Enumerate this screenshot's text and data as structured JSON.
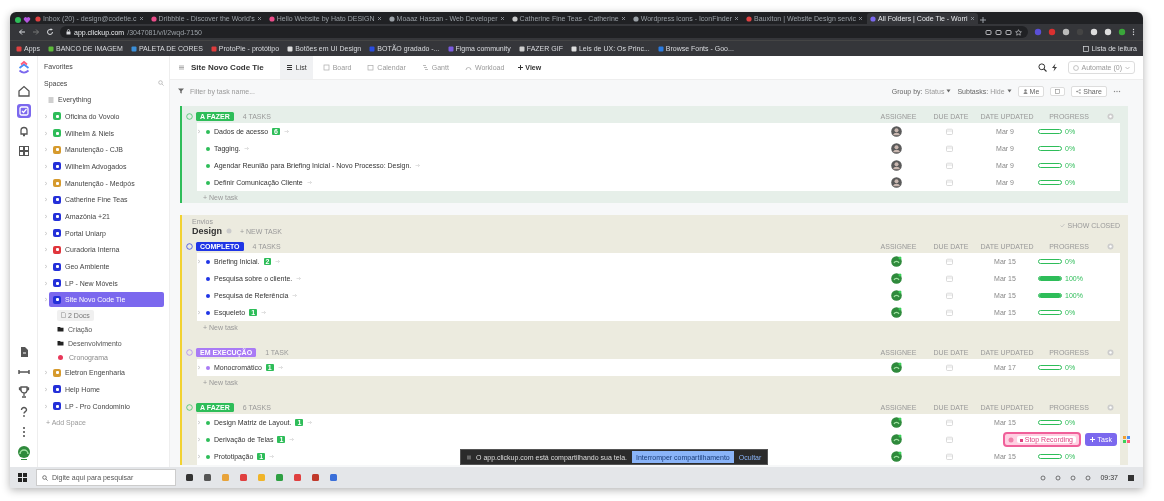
{
  "browser": {
    "tabs": [
      {
        "title": "Inbox (20) - design@codetie.c",
        "selected": false
      },
      {
        "title": "Dribbble - Discover the World's",
        "selected": false
      },
      {
        "title": "Hello Website by Hato DESIGN",
        "selected": false
      },
      {
        "title": "Moaaz Hassan - Web Developer",
        "selected": false
      },
      {
        "title": "Catherine Fine Teas - Catherine",
        "selected": false
      },
      {
        "title": "Wordpress icons - IconFinder",
        "selected": false
      },
      {
        "title": "Bauxiton | Website Design servic",
        "selected": false
      },
      {
        "title": "All Folders | Code Tie - Worri",
        "selected": true
      }
    ],
    "url_host": "app.clickup.com",
    "url_path": "/3047081/v/l/2wqd-7150",
    "bookmarks": [
      "Apps",
      "BANCO DE IMAGEM",
      "PALETA DE CORES",
      "ProtoPie - protótipo",
      "Botões em UI Design",
      "BOTÃO gradado -...",
      "Figma community",
      "FAZER GIF",
      "Leis de UX: Os Princ...",
      "Browse Fonts - Goo..."
    ],
    "reading_list": "Lista de leitura"
  },
  "rail": {
    "items": [
      {
        "kind": "home",
        "selected": false
      },
      {
        "kind": "tasks",
        "selected": true
      },
      {
        "kind": "notifications",
        "selected": false
      },
      {
        "kind": "apps",
        "selected": false
      }
    ],
    "bottom": [
      {
        "kind": "docs"
      },
      {
        "kind": "pulse"
      },
      {
        "kind": "goals"
      },
      {
        "kind": "help"
      },
      {
        "kind": "more"
      }
    ]
  },
  "sidebar": {
    "favorites": "Favorites",
    "spaces_label": "Spaces",
    "everything": "Everything",
    "spaces": [
      {
        "name": "Oficina do Vovoio",
        "color": "#2ebd59",
        "selected": false
      },
      {
        "name": "Wilhelm & Niels",
        "color": "#2ebd59",
        "selected": false
      },
      {
        "name": "Manutenção - CJB",
        "color": "#d69a2d",
        "selected": false
      },
      {
        "name": "Wilhelm Advogados",
        "color": "#2430d9",
        "selected": false
      },
      {
        "name": "Manutenção - Medpós",
        "color": "#d69a2d",
        "selected": false
      },
      {
        "name": "Catherine Fine Teas",
        "color": "#2430d9",
        "selected": false
      },
      {
        "name": "Amazônia +21",
        "color": "#2430d9",
        "selected": false
      },
      {
        "name": "Portal Uniarp",
        "color": "#2430d9",
        "selected": false
      },
      {
        "name": "Curadoria Interna",
        "color": "#e0353c",
        "selected": false
      },
      {
        "name": "Geo Ambiente",
        "color": "#2430d9",
        "selected": false
      },
      {
        "name": "LP - New Móveis",
        "color": "#2430d9",
        "selected": false
      },
      {
        "name": "Site Novo Code Tie",
        "color": "#2430d9",
        "selected": true,
        "children": [
          {
            "kind": "docs",
            "name": "2 Docs"
          },
          {
            "kind": "folder",
            "name": "Criação"
          },
          {
            "kind": "folder",
            "name": "Desenvolvimento"
          },
          {
            "kind": "list",
            "name": "Cronograma",
            "color": "#e8385a"
          }
        ]
      },
      {
        "name": "Eletron Engenharia",
        "color": "#d69a2d",
        "selected": false
      },
      {
        "name": "Help Home",
        "color": "#2430d9",
        "selected": false
      },
      {
        "name": "LP - Pro Condominio",
        "color": "#2430d9",
        "selected": false
      }
    ],
    "add_space": "+ Add Space"
  },
  "header": {
    "title": "Site Novo Code Tie",
    "views": [
      {
        "label": "List",
        "kind": "list",
        "selected": true
      },
      {
        "label": "Board",
        "kind": "board",
        "selected": false
      },
      {
        "label": "Calendar",
        "kind": "calendar",
        "selected": false
      },
      {
        "label": "Gantt",
        "kind": "gantt",
        "selected": false
      },
      {
        "label": "Workload",
        "kind": "workload",
        "selected": false
      }
    ],
    "add_view": "View",
    "automate": "Automate (0)"
  },
  "toolbar": {
    "filter_placeholder": "Filter by task name...",
    "group_by_label": "Group by:",
    "group_by": "Status",
    "subtasks_label": "Subtasks:",
    "subtasks": "Hide",
    "me": "Me",
    "share": "Share"
  },
  "lists": [
    {
      "color": "#2ebd59",
      "groups": [
        {
          "status": "A FAZER",
          "color": "#2ebd59",
          "count": "4 TASKS",
          "columns": [
            "ASSIGNEE",
            "DUE DATE",
            "DATE UPDATED",
            "PROGRESS"
          ],
          "new_task": "+ New task",
          "tasks": [
            {
              "name": "Dados de acesso",
              "subtasks": "6",
              "assignee": {
                "kind": "photo"
              },
              "date_updated": "Mar 9",
              "level": 0,
              "progress": "0%"
            },
            {
              "name": "Tagging.",
              "assignee": {
                "kind": "photo"
              },
              "date_updated": "Mar 9",
              "level": 0,
              "progress": "0%"
            },
            {
              "name": "Agendar Reunião para Briefing Inicial - Novo Processo: Design.",
              "assignee": {
                "kind": "photo"
              },
              "date_updated": "Mar 9",
              "level": 0,
              "progress": "0%"
            },
            {
              "name": "Definir Comunicação Cliente",
              "assignee": {
                "kind": "photo"
              },
              "date_updated": "Mar 9",
              "level": 0,
              "progress": "0%"
            }
          ]
        }
      ]
    },
    {
      "color": "#f2d230",
      "label": "Envios",
      "name": "Design",
      "new_task": "+ NEW TASK",
      "show_closed": "SHOW CLOSED",
      "groups": [
        {
          "status": "COMPLETO",
          "color": "#1f35e6",
          "count": "4 TASKS",
          "columns": [
            "ASSIGNEE",
            "DUE DATE",
            "DATE UPDATED",
            "PROGRESS"
          ],
          "new_task": "+ New task",
          "tasks": [
            {
              "name": "Briefing Inicial.",
              "subtasks": "2",
              "assignee": {
                "kind": "badge"
              },
              "date_updated": "Mar 15",
              "level": 0,
              "progress": "0%"
            },
            {
              "name": "Pesquisa sobre o cliente.",
              "assignee": {
                "kind": "badge"
              },
              "date_updated": "Mar 15",
              "level": 1,
              "progress": "100%"
            },
            {
              "name": "Pesquisa de Referência",
              "assignee": {
                "kind": "badge"
              },
              "date_updated": "Mar 15",
              "level": 1,
              "progress": "100%"
            },
            {
              "name": "Esqueleto",
              "subtasks": "1",
              "assignee": {
                "kind": "badge"
              },
              "date_updated": "Mar 15",
              "level": 0,
              "progress": "0%"
            }
          ]
        },
        {
          "status": "EM EXECUÇÃO",
          "color": "#a97bf5",
          "count": "1 TASK",
          "columns": [
            "ASSIGNEE",
            "DUE DATE",
            "DATE UPDATED",
            "PROGRESS"
          ],
          "new_task": "+ New task",
          "tasks": [
            {
              "name": "Monocromático",
              "subtasks": "1",
              "assignee": {
                "kind": "badge"
              },
              "date_updated": "Mar 17",
              "level": 0,
              "progress": "0%"
            }
          ]
        },
        {
          "status": "A FAZER",
          "color": "#2ebd59",
          "count": "6 TASKS",
          "columns": [
            "ASSIGNEE",
            "DUE DATE",
            "DATE UPDATED",
            "PROGRESS"
          ],
          "tasks": [
            {
              "name": "Design Matriz de Layout.",
              "subtasks": "1",
              "assignee": {
                "kind": "badge"
              },
              "date_updated": "Mar 15",
              "level": 0,
              "progress": "0%"
            },
            {
              "name": "Derivação de Telas",
              "subtasks": "1",
              "assignee": {
                "kind": "badge"
              }
            },
            {
              "name": "Prototipação",
              "subtasks": "1",
              "assignee": {
                "kind": "badge"
              },
              "date_updated": "Mar 15",
              "level": 0,
              "progress": "0%"
            }
          ]
        }
      ]
    }
  ],
  "share_bar": {
    "message": "O app.clickup.com está compartilhando sua tela.",
    "stop": "Interromper compartilhamento",
    "hide": "Ocultar"
  },
  "recording": {
    "stop": "Stop Recording"
  },
  "task_button": "Task",
  "taskbar": {
    "search_placeholder": "Digite aqui para pesquisar",
    "time": "09:37"
  }
}
